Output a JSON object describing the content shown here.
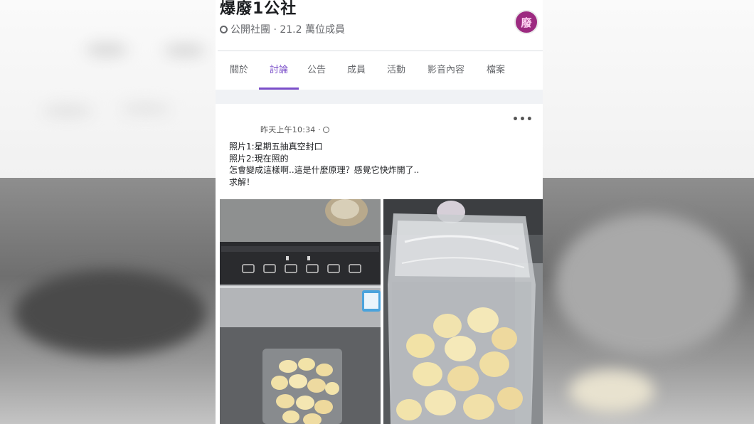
{
  "group": {
    "name": "爆廢1公社",
    "meta": "公開社團 · 21.2 萬位成員",
    "avatar_text": "廢"
  },
  "tabs": [
    {
      "label": "關於",
      "active": false
    },
    {
      "label": "討論",
      "active": true
    },
    {
      "label": "公告",
      "active": false
    },
    {
      "label": "成員",
      "active": false
    },
    {
      "label": "活動",
      "active": false
    },
    {
      "label": "影音內容",
      "active": false
    },
    {
      "label": "檔案",
      "active": false
    }
  ],
  "post": {
    "time": "昨天上午10:34 ·",
    "more_label": "•••",
    "lines": [
      "照片1:星期五抽真空封口",
      "照片2:現在照的",
      "怎會變成這樣啊..這是什麼原理？感覺它快炸開了..",
      "求解！"
    ],
    "photos": [
      {
        "subject": "vacuum sealer with sealed bag of peeled garlic"
      },
      {
        "subject": "bag of peeled garlic puffed up with air"
      }
    ]
  },
  "colors": {
    "accent": "#7b4fc9",
    "text_primary": "#1c1e21",
    "text_secondary": "#65676b",
    "avatar_bg": "#9c2a80"
  }
}
